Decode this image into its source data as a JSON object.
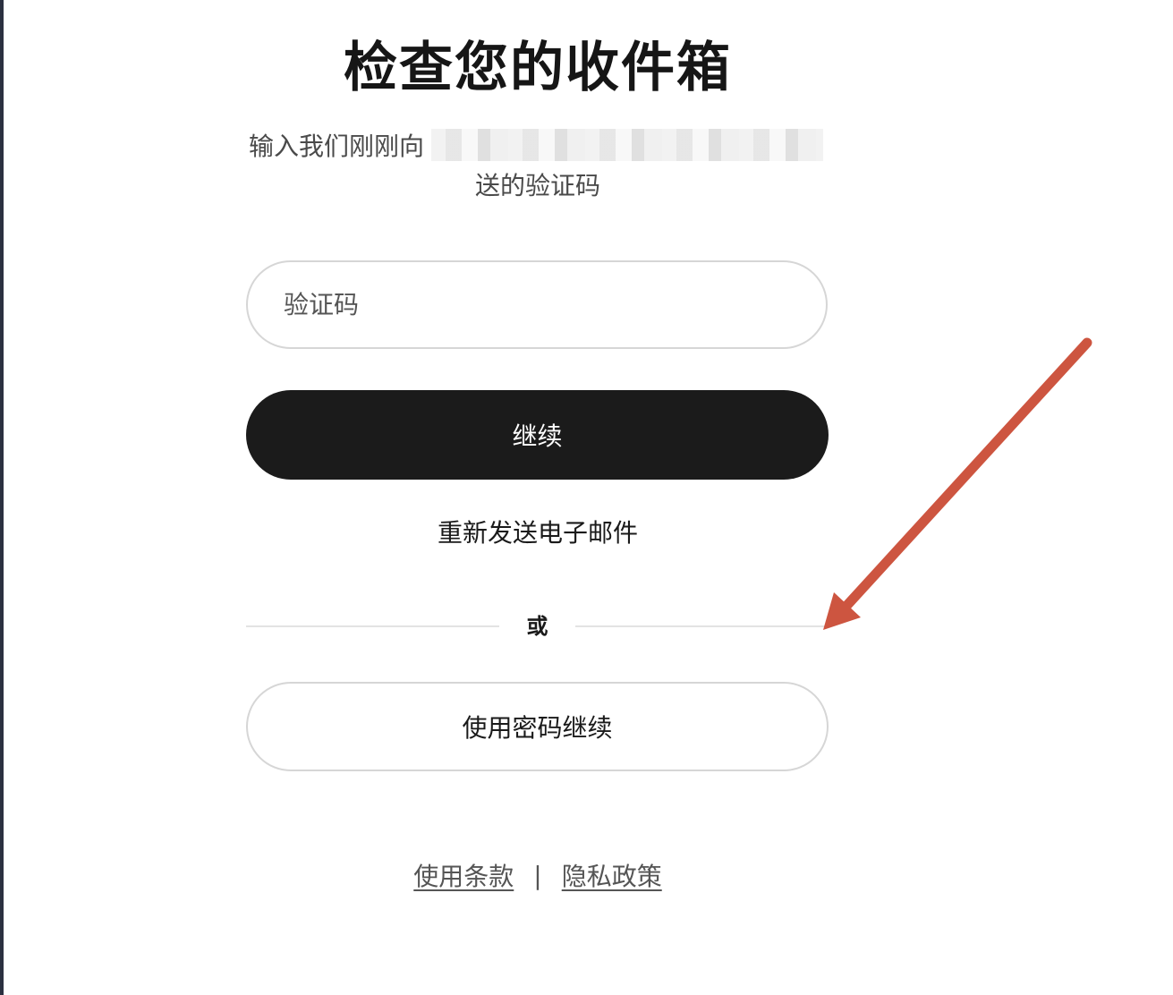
{
  "heading": "检查您的收件箱",
  "subtitle": {
    "prefix": "输入我们刚刚向",
    "suffix": "送的验证码"
  },
  "code_input": {
    "placeholder": "验证码",
    "value": ""
  },
  "continue_button": {
    "label": "继续"
  },
  "resend_link": {
    "label": "重新发送电子邮件"
  },
  "divider": {
    "label": "或"
  },
  "password_button": {
    "label": "使用密码继续"
  },
  "footer": {
    "terms_label": "使用条款",
    "separator": "|",
    "privacy_label": "隐私政策"
  },
  "annotation": {
    "arrow_color": "#cd5540"
  },
  "colors": {
    "primary_button_bg": "#1b1b1b",
    "border": "#d6d6d6"
  }
}
